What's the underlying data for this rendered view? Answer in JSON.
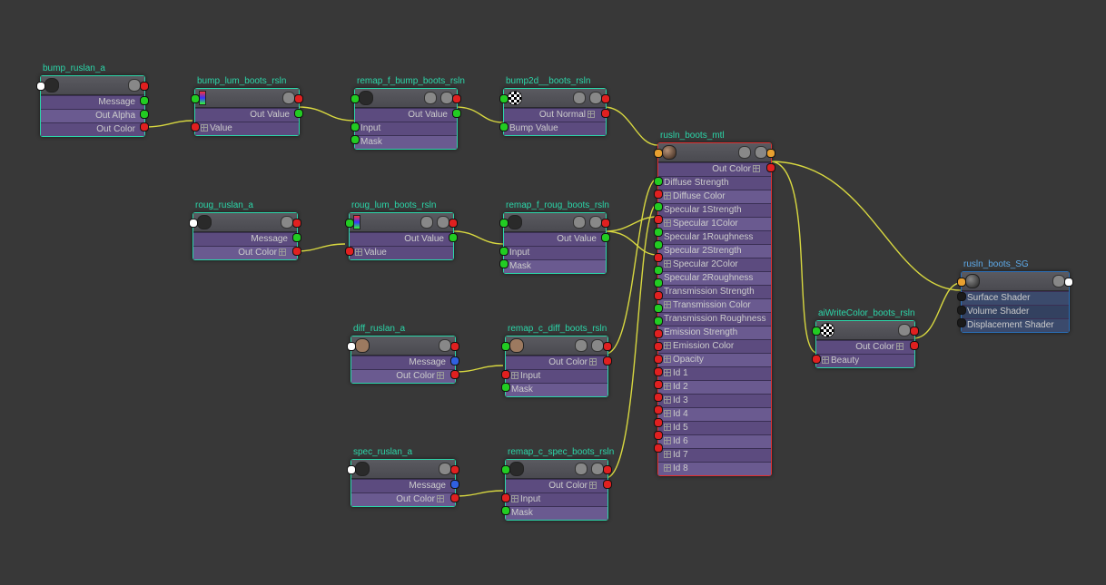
{
  "nodes": {
    "bump_ruslan": {
      "title": "bump_ruslan_a",
      "rows": [
        "Message",
        "Out Alpha",
        "Out Color"
      ]
    },
    "bump_lum": {
      "title": "bump_lum_boots_rsln",
      "out": "Out Value",
      "rows": [
        "Value"
      ]
    },
    "remap_f_bump": {
      "title": "remap_f_bump_boots_rsln",
      "out": "Out Value",
      "rows": [
        "Input",
        "Mask"
      ]
    },
    "bump2d": {
      "title": "bump2d__boots_rsln",
      "out": "Out Normal",
      "rows": [
        "Bump Value"
      ]
    },
    "roug_ruslan": {
      "title": "roug_ruslan_a",
      "rows": [
        "Message",
        "Out Color"
      ]
    },
    "roug_lum": {
      "title": "roug_lum_boots_rsln",
      "out": "Out Value",
      "rows": [
        "Value"
      ]
    },
    "remap_f_roug": {
      "title": "remap_f_roug_boots_rsln",
      "out": "Out Value",
      "rows": [
        "Input",
        "Mask"
      ]
    },
    "diff_ruslan": {
      "title": "diff_ruslan_a",
      "rows": [
        "Message",
        "Out Color"
      ]
    },
    "remap_c_diff": {
      "title": "remap_c_diff_boots_rsln",
      "out": "Out Color",
      "rows": [
        "Input",
        "Mask"
      ]
    },
    "spec_ruslan": {
      "title": "spec_ruslan_a",
      "rows": [
        "Message",
        "Out Color"
      ]
    },
    "remap_c_spec": {
      "title": "remap_c_spec_boots_rsln",
      "out": "Out Color",
      "rows": [
        "Input",
        "Mask"
      ]
    },
    "master": {
      "title": "rusln_boots_mtl",
      "out": "Out Color",
      "rows": [
        "Diffuse Strength",
        "Diffuse Color",
        "Specular 1Strength",
        "Specular 1Color",
        "Specular 1Roughness",
        "Specular 2Strength",
        "Specular 2Color",
        "Specular 2Roughness",
        "Transmission Strength",
        "Transmission Color",
        "Transmission Roughness",
        "Emission Strength",
        "Emission Color",
        "Opacity",
        "Id 1",
        "Id 2",
        "Id 3",
        "Id 4",
        "Id 5",
        "Id 6",
        "Id 7",
        "Id 8"
      ]
    },
    "aiwrite": {
      "title": "aiWriteColor_boots_rsln",
      "out": "Out Color",
      "rows": [
        "Beauty"
      ]
    },
    "sg": {
      "title": "rusln_boots_SG",
      "rows": [
        "Surface Shader",
        "Volume Shader",
        "Displacement Shader"
      ]
    }
  }
}
